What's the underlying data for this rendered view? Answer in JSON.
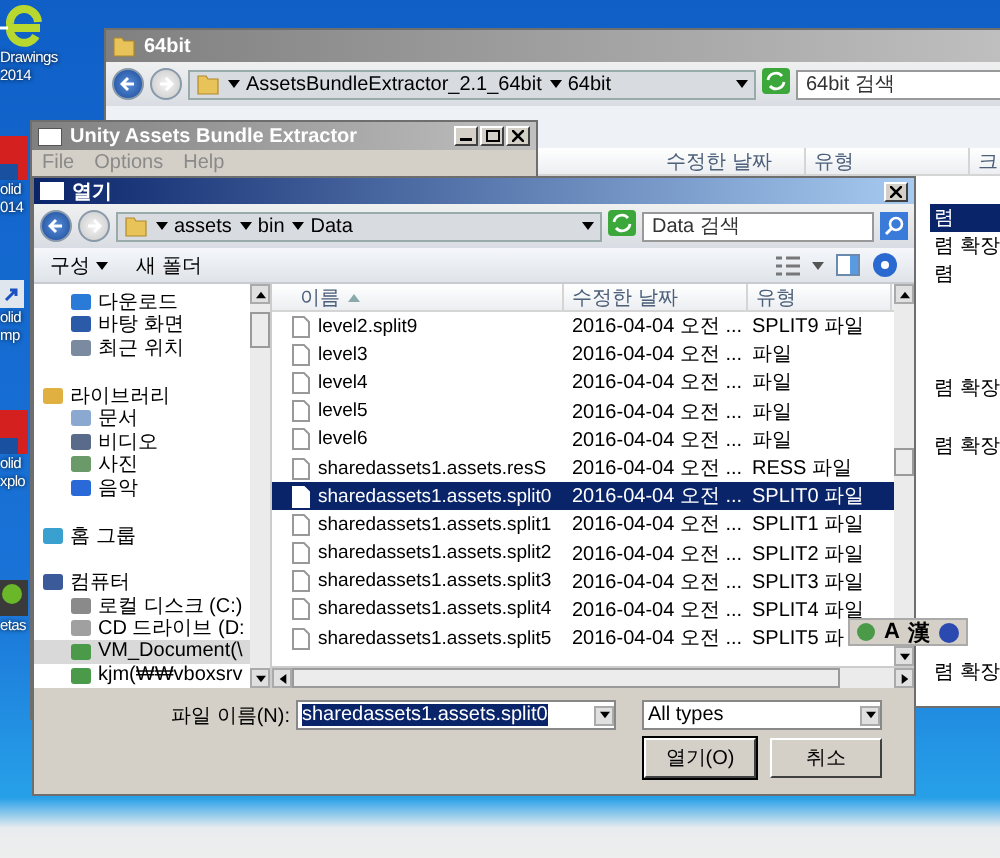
{
  "desktop": {
    "icons": [
      {
        "kind": "logo",
        "lines": [
          "Drawings",
          "2014"
        ]
      },
      {
        "kind": "red",
        "lines": [
          "olid",
          "014"
        ]
      },
      {
        "kind": "shortcut",
        "lines": [
          "olid",
          "mp"
        ]
      },
      {
        "kind": "red",
        "lines": [
          "olid",
          "xplo"
        ]
      },
      {
        "kind": "green",
        "lines": [
          "etas"
        ]
      }
    ]
  },
  "back_window": {
    "title": "64bit",
    "breadcrumb": [
      "AssetsBundleExtractor_2.1_64bit",
      "64bit"
    ],
    "search": {
      "placeholder": "64bit 검색"
    },
    "columns": [
      "수정한 날짜",
      "유형",
      "크"
    ],
    "items": [
      {
        "text": "렴",
        "selected": true
      },
      {
        "text": "렴 확장",
        "selected": false
      },
      {
        "text": "렴",
        "selected": false
      },
      {
        "text": "렴 확장",
        "selected": false
      },
      {
        "text": "렴 확장",
        "selected": false
      },
      {
        "text": "렴 확장",
        "selected": false
      }
    ]
  },
  "extractor_window": {
    "title": "Unity Assets Bundle Extractor",
    "menu": [
      "File",
      "Options",
      "Help"
    ]
  },
  "open_dialog": {
    "title": "열기",
    "breadcrumb": [
      "assets",
      "bin",
      "Data"
    ],
    "search": {
      "placeholder": "Data 검색"
    },
    "toolbar": [
      "구성",
      "새 폴더"
    ],
    "nav": [
      {
        "children": [
          {
            "label": "다운로드",
            "kind": "download",
            "selected": false
          },
          {
            "label": "바탕 화면",
            "kind": "desktop",
            "selected": false
          },
          {
            "label": "최근 위치",
            "kind": "recent",
            "selected": false
          }
        ]
      },
      {
        "label": "라이브러리",
        "kind": "library",
        "selected": false,
        "children": [
          {
            "label": "문서",
            "kind": "document",
            "selected": false
          },
          {
            "label": "비디오",
            "kind": "video",
            "selected": false
          },
          {
            "label": "사진",
            "kind": "photo",
            "selected": false
          },
          {
            "label": "음악",
            "kind": "music",
            "selected": false
          }
        ]
      },
      {
        "label": "홈 그룹",
        "kind": "homegroup",
        "selected": false
      },
      {
        "label": "컴퓨터",
        "kind": "computer",
        "selected": false,
        "children": [
          {
            "label": "로컬 디스크 (C:)",
            "kind": "disk",
            "selected": false
          },
          {
            "label": "CD 드라이브 (D:",
            "kind": "cd",
            "selected": false
          },
          {
            "label": "VM_Document(\\",
            "kind": "network",
            "selected": true
          },
          {
            "label": "kjm(₩₩vboxsrv",
            "kind": "network",
            "selected": false
          }
        ]
      }
    ],
    "columns": [
      "이름",
      "수정한 날짜",
      "유형"
    ],
    "rows": [
      {
        "name": "level2.split9",
        "modified": "2016-04-04 오전 ...",
        "type": "SPLIT9 파일",
        "selected": false
      },
      {
        "name": "level3",
        "modified": "2016-04-04 오전 ...",
        "type": "파일",
        "selected": false
      },
      {
        "name": "level4",
        "modified": "2016-04-04 오전 ...",
        "type": "파일",
        "selected": false
      },
      {
        "name": "level5",
        "modified": "2016-04-04 오전 ...",
        "type": "파일",
        "selected": false
      },
      {
        "name": "level6",
        "modified": "2016-04-04 오전 ...",
        "type": "파일",
        "selected": false
      },
      {
        "name": "sharedassets1.assets.resS",
        "modified": "2016-04-04 오전 ...",
        "type": "RESS 파일",
        "selected": false
      },
      {
        "name": "sharedassets1.assets.split0",
        "modified": "2016-04-04 오전 ...",
        "type": "SPLIT0 파일",
        "selected": true
      },
      {
        "name": "sharedassets1.assets.split1",
        "modified": "2016-04-04 오전 ...",
        "type": "SPLIT1 파일",
        "selected": false
      },
      {
        "name": "sharedassets1.assets.split2",
        "modified": "2016-04-04 오전 ...",
        "type": "SPLIT2 파일",
        "selected": false
      },
      {
        "name": "sharedassets1.assets.split3",
        "modified": "2016-04-04 오전 ...",
        "type": "SPLIT3 파일",
        "selected": false
      },
      {
        "name": "sharedassets1.assets.split4",
        "modified": "2016-04-04 오전 ...",
        "type": "SPLIT4 파일",
        "selected": false
      },
      {
        "name": "sharedassets1.assets.split5",
        "modified": "2016-04-04 오전 ...",
        "type": "SPLIT5 파",
        "selected": false
      }
    ],
    "filename": {
      "label": "파일 이름(N):",
      "value": "sharedassets1.assets.split0"
    },
    "filetype": {
      "value": "All types"
    },
    "buttons": [
      "열기(O)",
      "취소"
    ]
  },
  "ime_bar": {
    "keys": [
      "A",
      "漢"
    ]
  }
}
